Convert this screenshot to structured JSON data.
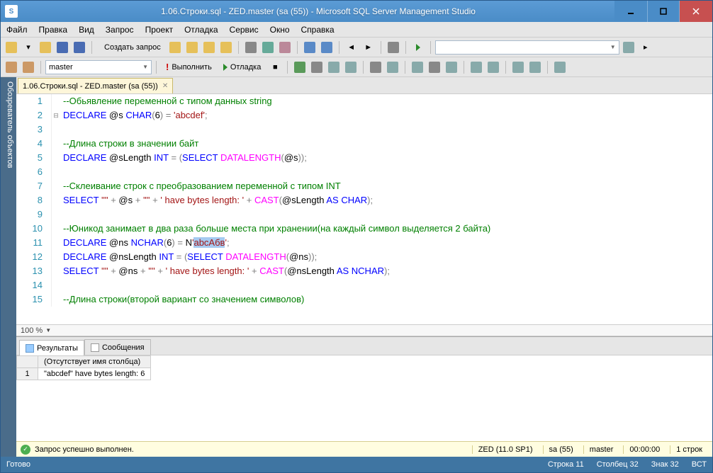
{
  "title": "1.06.Строки.sql - ZED.master (sa (55)) - Microsoft SQL Server Management Studio",
  "menu": [
    "Файл",
    "Правка",
    "Вид",
    "Запрос",
    "Проект",
    "Отладка",
    "Сервис",
    "Окно",
    "Справка"
  ],
  "toolbar1": {
    "new_query": "Создать запрос"
  },
  "toolbar2": {
    "db_combo": "master",
    "execute": "Выполнить",
    "debug": "Отладка"
  },
  "side_panel": "Обозреватель объектов",
  "doc_tab": {
    "label": "1.06.Строки.sql - ZED.master (sa (55))"
  },
  "zoom": "100 %",
  "code_lines": [
    {
      "n": 1,
      "seg": [
        [
          "c-comment",
          "--Обьявление переменной с типом данных string"
        ]
      ]
    },
    {
      "n": 2,
      "fold": "⊟",
      "seg": [
        [
          "c-kw",
          "DECLARE"
        ],
        [
          "",
          " "
        ],
        [
          "c-var",
          "@s"
        ],
        [
          "",
          " "
        ],
        [
          "c-kw",
          "CHAR"
        ],
        [
          "c-op",
          "("
        ],
        [
          "c-num",
          "6"
        ],
        [
          "c-op",
          ")"
        ],
        [
          "",
          " "
        ],
        [
          "c-op",
          "="
        ],
        [
          "",
          " "
        ],
        [
          "c-str",
          "'abcdef'"
        ],
        [
          "c-op",
          ";"
        ]
      ]
    },
    {
      "n": 3,
      "seg": [
        [
          "",
          ""
        ]
      ]
    },
    {
      "n": 4,
      "seg": [
        [
          "c-comment",
          "--Длина строки в значении байт"
        ]
      ]
    },
    {
      "n": 5,
      "seg": [
        [
          "c-kw",
          "DECLARE"
        ],
        [
          "",
          " "
        ],
        [
          "c-var",
          "@sLength"
        ],
        [
          "",
          " "
        ],
        [
          "c-kw",
          "INT"
        ],
        [
          "",
          " "
        ],
        [
          "c-op",
          "="
        ],
        [
          "",
          " "
        ],
        [
          "c-op",
          "("
        ],
        [
          "c-kw",
          "SELECT"
        ],
        [
          "",
          " "
        ],
        [
          "c-func",
          "DATALENGTH"
        ],
        [
          "c-op",
          "("
        ],
        [
          "c-var",
          "@s"
        ],
        [
          "c-op",
          "));"
        ]
      ]
    },
    {
      "n": 6,
      "seg": [
        [
          "",
          ""
        ]
      ]
    },
    {
      "n": 7,
      "seg": [
        [
          "c-comment",
          "--Склеивание строк с преобразованием переменной с типом INT"
        ]
      ]
    },
    {
      "n": 8,
      "seg": [
        [
          "c-kw",
          "SELECT"
        ],
        [
          "",
          " "
        ],
        [
          "c-str",
          "'\"'"
        ],
        [
          "",
          " "
        ],
        [
          "c-op",
          "+"
        ],
        [
          "",
          " "
        ],
        [
          "c-var",
          "@s"
        ],
        [
          "",
          " "
        ],
        [
          "c-op",
          "+"
        ],
        [
          "",
          " "
        ],
        [
          "c-str",
          "'\"'"
        ],
        [
          "",
          " "
        ],
        [
          "c-op",
          "+"
        ],
        [
          "",
          " "
        ],
        [
          "c-str",
          "' have bytes length: '"
        ],
        [
          "",
          " "
        ],
        [
          "c-op",
          "+"
        ],
        [
          "",
          " "
        ],
        [
          "c-func",
          "CAST"
        ],
        [
          "c-op",
          "("
        ],
        [
          "c-var",
          "@sLength"
        ],
        [
          "",
          " "
        ],
        [
          "c-kw",
          "AS"
        ],
        [
          "",
          " "
        ],
        [
          "c-kw",
          "CHAR"
        ],
        [
          "c-op",
          ");"
        ]
      ]
    },
    {
      "n": 9,
      "seg": [
        [
          "",
          ""
        ]
      ]
    },
    {
      "n": 10,
      "seg": [
        [
          "c-comment",
          "--Юникод занимает в два раза больше места при хранении(на каждый символ выделяется 2 байта)"
        ]
      ]
    },
    {
      "n": 11,
      "cursor": true,
      "seg": [
        [
          "c-kw",
          "DECLARE"
        ],
        [
          "",
          " "
        ],
        [
          "c-var",
          "@ns"
        ],
        [
          "",
          " "
        ],
        [
          "c-kw",
          "NCHAR"
        ],
        [
          "c-op",
          "("
        ],
        [
          "c-num",
          "6"
        ],
        [
          "c-op",
          ")"
        ],
        [
          "",
          " "
        ],
        [
          "c-op",
          "="
        ],
        [
          "",
          " N"
        ],
        [
          "c-str",
          "'"
        ],
        [
          "c-str c-sel",
          "abcАбв"
        ],
        [
          "c-str",
          "'"
        ],
        [
          "c-op",
          ";"
        ]
      ]
    },
    {
      "n": 12,
      "seg": [
        [
          "c-kw",
          "DECLARE"
        ],
        [
          "",
          " "
        ],
        [
          "c-var",
          "@nsLength"
        ],
        [
          "",
          " "
        ],
        [
          "c-kw",
          "INT"
        ],
        [
          "",
          " "
        ],
        [
          "c-op",
          "="
        ],
        [
          "",
          " "
        ],
        [
          "c-op",
          "("
        ],
        [
          "c-kw",
          "SELECT"
        ],
        [
          "",
          " "
        ],
        [
          "c-func",
          "DATALENGTH"
        ],
        [
          "c-op",
          "("
        ],
        [
          "c-var",
          "@ns"
        ],
        [
          "c-op",
          "));"
        ]
      ]
    },
    {
      "n": 13,
      "seg": [
        [
          "c-kw",
          "SELECT"
        ],
        [
          "",
          " "
        ],
        [
          "c-str",
          "'\"'"
        ],
        [
          "",
          " "
        ],
        [
          "c-op",
          "+"
        ],
        [
          "",
          " "
        ],
        [
          "c-var",
          "@ns"
        ],
        [
          "",
          " "
        ],
        [
          "c-op",
          "+"
        ],
        [
          "",
          " "
        ],
        [
          "c-str",
          "'\"'"
        ],
        [
          "",
          " "
        ],
        [
          "c-op",
          "+"
        ],
        [
          "",
          " "
        ],
        [
          "c-str",
          "' have bytes length: '"
        ],
        [
          "",
          " "
        ],
        [
          "c-op",
          "+"
        ],
        [
          "",
          " "
        ],
        [
          "c-func",
          "CAST"
        ],
        [
          "c-op",
          "("
        ],
        [
          "c-var",
          "@nsLength"
        ],
        [
          "",
          " "
        ],
        [
          "c-kw",
          "AS"
        ],
        [
          "",
          " "
        ],
        [
          "c-kw",
          "NCHAR"
        ],
        [
          "c-op",
          ");"
        ]
      ]
    },
    {
      "n": 14,
      "seg": [
        [
          "",
          ""
        ]
      ]
    },
    {
      "n": 15,
      "seg": [
        [
          "c-comment",
          "--Длина строки(второй вариант со значением символов)"
        ]
      ]
    }
  ],
  "results": {
    "tab_results": "Результаты",
    "tab_messages": "Сообщения",
    "col_header": "(Отсутствует имя столбца)",
    "row_num": "1",
    "cell": "\"abcdef\" have bytes length: 6"
  },
  "result_status": {
    "ok_text": "Запрос успешно выполнен.",
    "server": "ZED (11.0 SP1)",
    "login": "sa (55)",
    "db": "master",
    "time": "00:00:00",
    "rows": "1 строк"
  },
  "statusbar": {
    "ready": "Готово",
    "line": "Строка 11",
    "col": "Столбец 32",
    "char": "Знак 32",
    "ins": "ВСТ"
  }
}
